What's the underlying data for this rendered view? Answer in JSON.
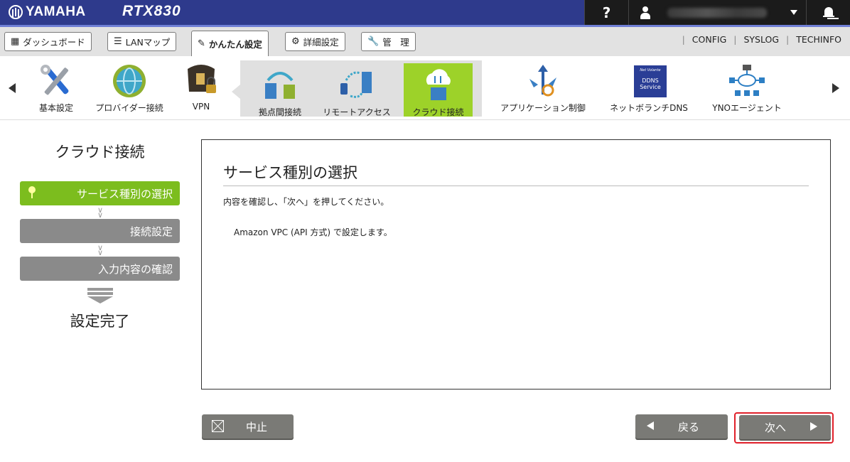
{
  "brand": {
    "logo": "YAMAHA",
    "model": "RTX830"
  },
  "topbar": {
    "help_label": "?",
    "user_name": ""
  },
  "tabs": [
    {
      "label": "ダッシュボード",
      "icon": "dashboard-icon"
    },
    {
      "label": "LANマップ",
      "icon": "lan-map-icon"
    },
    {
      "label": "かんたん設定",
      "icon": "wizard-icon",
      "active": true
    },
    {
      "label": "詳細設定",
      "icon": "gear-icon"
    },
    {
      "label": "管　理",
      "icon": "wrench-icon"
    }
  ],
  "top_links": [
    "CONFIG",
    "SYSLOG",
    "TECHINFO"
  ],
  "icon_menu": [
    {
      "label": "基本設定",
      "icon": "tools-icon"
    },
    {
      "label": "プロバイダー接続",
      "icon": "globe-icon"
    },
    {
      "label": "VPN",
      "icon": "vpn-lock-icon"
    },
    {
      "label": "拠点間接続",
      "icon": "site-to-site-icon"
    },
    {
      "label": "リモートアクセス",
      "icon": "remote-access-icon"
    },
    {
      "label": "クラウド接続",
      "icon": "cloud-icon",
      "active": true
    },
    {
      "label": "アプリケーション制御",
      "icon": "app-control-icon"
    },
    {
      "label": "ネットボランチDNS",
      "icon": "ddns-icon",
      "icon_text": [
        "Net Volante",
        "DDNS",
        "Service"
      ]
    },
    {
      "label": "YNOエージェント",
      "icon": "yno-network-icon"
    }
  ],
  "sidebar": {
    "title": "クラウド接続",
    "steps": [
      "サービス種別の選択",
      "接続設定",
      "入力内容の確認"
    ],
    "done": "設定完了"
  },
  "panel": {
    "title": "サービス種別の選択",
    "instruction": "内容を確認し、「次へ」を押してください。",
    "message": "Amazon VPC (API 方式) で設定します。"
  },
  "buttons": {
    "cancel": "中止",
    "back": "戻る",
    "next": "次へ"
  },
  "colors": {
    "topbar": "#2e3a8c",
    "active_green": "#7cbd1e",
    "menu_active": "#9dd229",
    "button_gray": "#7a7a76",
    "highlight_red": "#e0202a"
  }
}
